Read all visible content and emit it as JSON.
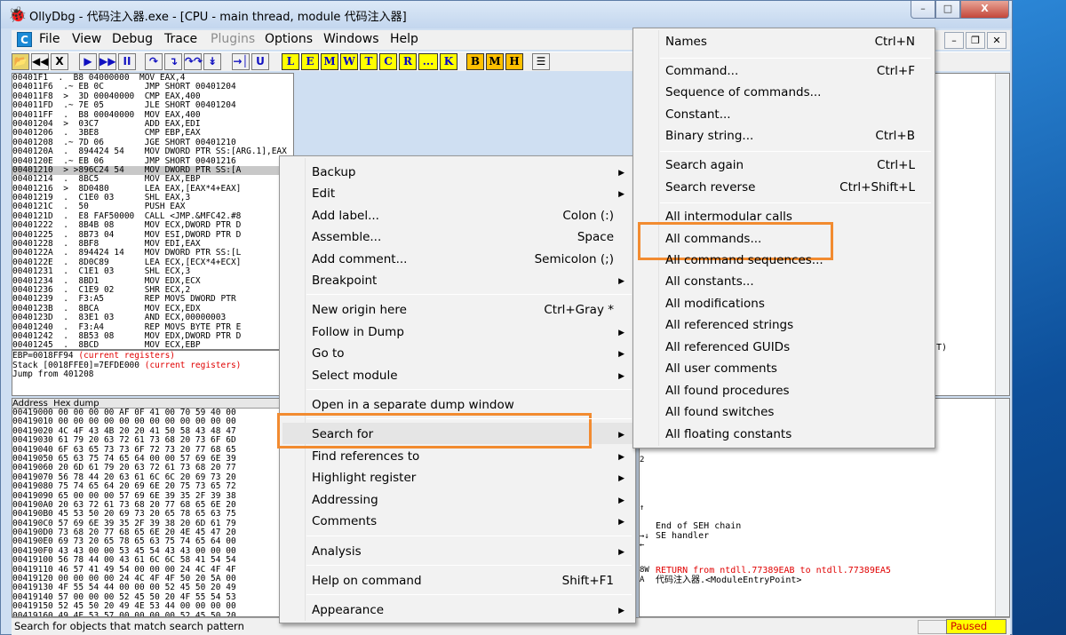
{
  "window": {
    "title": "OllyDbg - 代码注入器.exe - [CPU - main thread, module 代码注入器]"
  },
  "menubar": [
    "File",
    "View",
    "Debug",
    "Trace",
    "Plugins",
    "Options",
    "Windows",
    "Help"
  ],
  "toolbar": {
    "nav": [
      "◀◀",
      "X"
    ],
    "run": [
      "▶",
      "▶▶",
      "II"
    ],
    "trace": [
      "↷",
      "↴",
      "↷↷",
      "↡"
    ],
    "goto": [
      "→│",
      "U"
    ],
    "wins": [
      "L",
      "E",
      "M",
      "W",
      "T",
      "C",
      "R",
      "...",
      "K"
    ],
    "bp": [
      "B",
      "M",
      "H"
    ],
    "list": "☰"
  },
  "cpu_rows": [
    "00401F1  .  B8 04000000  MOV EAX,4",
    "004011F6  .~ EB 0C        JMP SHORT 00401204",
    "004011F8  >  3D 00040000  CMP EAX,400",
    "004011FD  .~ 7E 05        JLE SHORT 00401204",
    "004011FF  .  B8 00040000  MOV EAX,400",
    "00401204  >  03C7         ADD EAX,EDI",
    "00401206  .  3BE8         CMP EBP,EAX",
    "00401208  .~ 7D 06        JGE SHORT 00401210",
    "0040120A  .  894424 54    MOV DWORD PTR SS:[ARG.1],EAX",
    "0040120E  .~ EB 06        JMP SHORT 00401216",
    "00401210  > >896C24 54    MOV DWORD PTR SS:[A",
    "00401214  .  8BC5         MOV EAX,EBP",
    "00401216  >  8D0480       LEA EAX,[EAX*4+EAX]",
    "00401219  .  C1E0 03      SHL EAX,3",
    "0040121C  .  50           PUSH EAX",
    "0040121D  .  E8 FAF50000  CALL <JMP.&MFC42.#8",
    "00401222  .  8B4B 08      MOV ECX,DWORD PTR D",
    "00401225  .  8B73 04      MOV ESI,DWORD PTR D",
    "00401228  .  8BF8         MOV EDI,EAX",
    "0040122A  .  894424 14    MOV DWORD PTR SS:[L",
    "0040122E  .  8D0C89       LEA ECX,[ECX*4+ECX]",
    "00401231  .  C1E1 03      SHL ECX,3",
    "00401234  .  8BD1         MOV EDX,ECX",
    "00401236  .  C1E9 02      SHR ECX,2",
    "00401239  .  F3:A5        REP MOVS DWORD PTR",
    "0040123B  .  8BCA         MOV ECX,EDX",
    "0040123D  .  83E1 03      AND ECX,00000003",
    "00401240  .  F3:A4        REP MOVS BYTE PTR E",
    "00401242  .  8B53 08      MOV EDX,DWORD PTR D",
    "00401245  .  8BCD         MOV ECX,EBP",
    "00401247  .  2BCA         SUB ECX,EDX"
  ],
  "info": {
    "line1": "EBP=0018FF94",
    "line1_red": " (current registers)",
    "line2": "Stack [0018FFE0]=7EFDE000",
    "line2_red": " (current registers)",
    "line3": "Jump from 401208"
  },
  "dump": {
    "header": "Address  Hex dump",
    "rows": [
      "00419000 00 00 00 00 AF 0F 41 00 70 59 40 00",
      "00419010 00 00 00 00 00 00 00 00 00 00 00 00",
      "00419020 4C 4F 43 4B 20 20 41 50 58 43 48 47",
      "00419030 61 79 20 63 72 61 73 68 20 73 6F 6D",
      "00419040 6F 63 65 73 73 6F 72 73 20 77 68 65",
      "00419050 65 63 75 74 65 64 00 00 57 69 6E 39",
      "00419060 20 6D 61 79 20 63 72 61 73 68 20 77",
      "00419070 56 78 44 20 63 61 6C 6C 20 69 73 20",
      "00419080 75 74 65 64 20 69 6E 20 75 73 65 72",
      "00419090 65 00 00 00 57 69 6E 39 35 2F 39 38",
      "004190A0 20 63 72 61 73 68 20 77 68 65 6E 20",
      "004190B0 45 53 50 20 69 73 20 65 78 65 63 75",
      "004190C0 57 69 6E 39 35 2F 39 38 20 6D 61 79",
      "004190D0 73 68 20 77 68 65 6E 20 4E 45 47 20",
      "004190E0 69 73 20 65 78 65 63 75 74 65 64 00",
      "004190F0 43 43 00 00 53 45 54 43 43 00 00 00",
      "00419100 56 78 44 00 43 61 6C 6C 58 41 54 54",
      "00419110 46 57 41 49 54 00 00 00 24 4C 4F 4F",
      "00419120 00 00 00 00 24 4C 4F 4F 50 20 5A 00",
      "00419130 4F 55 54 44 00 00 00 52 45 50 20 49",
      "00419140 57 00 00 00 52 45 50 20 4F 55 54 53",
      "00419150 52 45 50 20 49 4E 53 44 00 00 00 00",
      "00419160 49 4E 53 57 00 00 00 00 52 45 50 20"
    ]
  },
  "regs_fragment": "T)",
  "stack": {
    "seh_end": "End of SEH chain",
    "se_handler": "SE handler",
    "ret_text": "RETURN from ntdll.77389EAB to ntdll.77389EA5",
    "entry": "代码注入器.<ModuleEntryPoint>",
    "marks": [
      "←",
      "↑",
      "→↓",
      "8W",
      "A",
      "2"
    ]
  },
  "status": {
    "text": "Search for objects that match search pattern",
    "state": "Paused"
  },
  "context_menu": {
    "items": [
      {
        "label": "Backup",
        "shortcut": "",
        "sub": true
      },
      {
        "label": "Edit",
        "shortcut": "",
        "sub": true
      },
      {
        "label": "Add label...",
        "shortcut": "Colon (:)",
        "sub": false
      },
      {
        "label": "Assemble...",
        "shortcut": "Space",
        "sub": false
      },
      {
        "label": "Add comment...",
        "shortcut": "Semicolon (;)",
        "sub": false
      },
      {
        "label": "Breakpoint",
        "shortcut": "",
        "sub": true
      },
      {
        "label": "New origin here",
        "shortcut": "Ctrl+Gray *",
        "sub": false
      },
      {
        "label": "Follow in Dump",
        "shortcut": "",
        "sub": true
      },
      {
        "label": "Go to",
        "shortcut": "",
        "sub": true
      },
      {
        "label": "Select module",
        "shortcut": "",
        "sub": true
      },
      {
        "label": "Open in a separate dump window",
        "shortcut": "",
        "sub": false
      },
      {
        "label": "Search for",
        "shortcut": "",
        "sub": true
      },
      {
        "label": "Find references to",
        "shortcut": "",
        "sub": true
      },
      {
        "label": "Highlight register",
        "shortcut": "",
        "sub": true
      },
      {
        "label": "Addressing",
        "shortcut": "",
        "sub": true
      },
      {
        "label": "Comments",
        "shortcut": "",
        "sub": true
      },
      {
        "label": "Analysis",
        "shortcut": "",
        "sub": true
      },
      {
        "label": "Help on command",
        "shortcut": "Shift+F1",
        "sub": false
      },
      {
        "label": "Appearance",
        "shortcut": "",
        "sub": true
      }
    ]
  },
  "submenu": {
    "items": [
      {
        "label": "Names",
        "shortcut": "Ctrl+N"
      },
      {
        "label": "Command...",
        "shortcut": "Ctrl+F"
      },
      {
        "label": "Sequence of commands...",
        "shortcut": ""
      },
      {
        "label": "Constant...",
        "shortcut": ""
      },
      {
        "label": "Binary string...",
        "shortcut": "Ctrl+B"
      },
      {
        "label": "Search again",
        "shortcut": "Ctrl+L"
      },
      {
        "label": "Search reverse",
        "shortcut": "Ctrl+Shift+L"
      },
      {
        "label": "All intermodular calls",
        "shortcut": ""
      },
      {
        "label": "All commands...",
        "shortcut": ""
      },
      {
        "label": "All command sequences...",
        "shortcut": ""
      },
      {
        "label": "All constants...",
        "shortcut": ""
      },
      {
        "label": "All modifications",
        "shortcut": ""
      },
      {
        "label": "All referenced strings",
        "shortcut": ""
      },
      {
        "label": "All referenced GUIDs",
        "shortcut": ""
      },
      {
        "label": "All user comments",
        "shortcut": ""
      },
      {
        "label": "All found procedures",
        "shortcut": ""
      },
      {
        "label": "All found switches",
        "shortcut": ""
      },
      {
        "label": "All floating constants",
        "shortcut": ""
      }
    ]
  },
  "colors": {
    "highlight": "#f28b30",
    "paused_bg": "#ffff00",
    "error_text": "#e00000"
  }
}
